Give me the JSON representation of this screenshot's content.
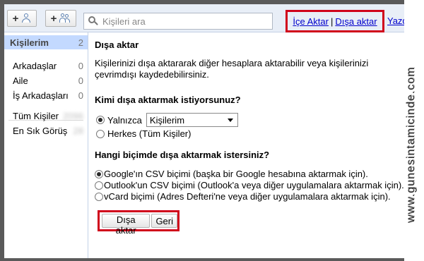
{
  "toolbar": {
    "search_placeholder": "Kişileri ara",
    "import_label": "İçe Aktar",
    "separator": "|",
    "export_label": "Dışa aktar",
    "print_label": "Yazdır",
    "add_contact_label": "+",
    "add_group_label": "+"
  },
  "sidebar": {
    "header": {
      "label": "Kişilerim",
      "count": "2"
    },
    "groups": [
      {
        "label": "Arkadaşlar",
        "count": "0"
      },
      {
        "label": "Aile",
        "count": "0"
      },
      {
        "label": "İş Arkadaşları",
        "count": "0"
      }
    ],
    "others": [
      {
        "label": "Tüm Kişiler",
        "count": "2096"
      },
      {
        "label": "En Sık Görüş",
        "count": "28"
      }
    ]
  },
  "main": {
    "title": "Dışa aktar",
    "description": "Kişilerinizi dışa aktararak diğer hesaplara aktarabilir veya kişilerinizi çevrimdışı kaydedebilirsiniz.",
    "who_question": "Kimi dışa aktarmak istiyorsunuz?",
    "who_options": {
      "only_label": "Yalnızca",
      "only_select_value": "Kişilerim",
      "everyone_label": "Herkes (Tüm Kişiler)",
      "selected": "only"
    },
    "format_question": "Hangi biçimde dışa aktarmak istersiniz?",
    "formats": [
      {
        "label": "Google'ın CSV biçimi (başka bir Google hesabına aktarmak için).",
        "checked": true
      },
      {
        "label": "Outlook'un CSV biçimi (Outlook'a veya diğer uygulamalara aktarmak için).",
        "checked": false
      },
      {
        "label": "vCard biçimi (Adres Defteri'ne veya diğer uygulamalara aktarmak için).",
        "checked": false
      }
    ],
    "export_button": "Dışa aktar",
    "back_button": "Geri"
  },
  "watermark": "www.gunesintamicinde.com",
  "colors": {
    "accent_blue": "#c3d9ff",
    "toolbar_bg": "#e8eef7",
    "highlight_red": "#d0021b",
    "link": "#0000cc"
  },
  "icons": [
    "add-contact-icon",
    "add-group-icon",
    "search-icon",
    "dropdown-arrow-icon"
  ]
}
